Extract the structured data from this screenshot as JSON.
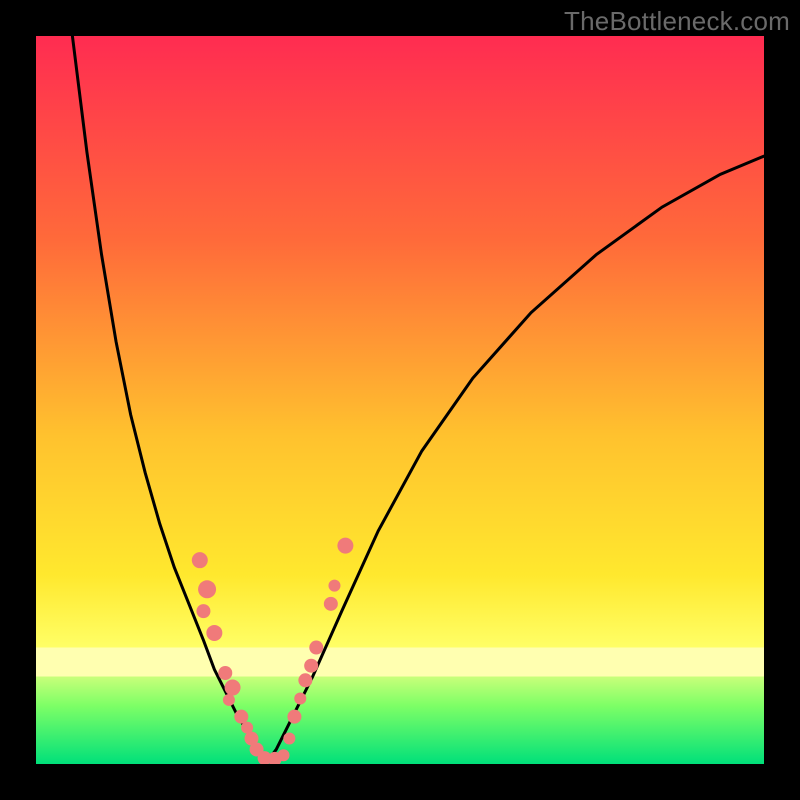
{
  "watermark": "TheBottleneck.com",
  "chart_data": {
    "type": "line",
    "title": "",
    "xlabel": "",
    "ylabel": "",
    "xlim": [
      0,
      100
    ],
    "ylim": [
      0,
      100
    ],
    "background_gradient": {
      "top": "#ff2c51",
      "mid_high": "#ff8a2e",
      "mid": "#ffe32e",
      "low_band_top": "#ffff8a",
      "green_top": "#8aff6a",
      "green_bottom": "#00e07a"
    },
    "curve_1": {
      "description": "left descending branch",
      "x": [
        5,
        7,
        9,
        11,
        13,
        15,
        17,
        19,
        21,
        23,
        24.5,
        26,
        27.5,
        29,
        30,
        31,
        31.5
      ],
      "y": [
        100,
        84,
        70,
        58,
        48,
        40,
        33,
        27,
        22,
        17,
        13,
        10,
        7,
        4.5,
        2.5,
        1,
        0
      ]
    },
    "curve_2": {
      "description": "right ascending branch",
      "x": [
        31.5,
        33,
        35,
        38,
        42,
        47,
        53,
        60,
        68,
        77,
        86,
        94,
        100
      ],
      "y": [
        0,
        2,
        6,
        12,
        21,
        32,
        43,
        53,
        62,
        70,
        76.5,
        81,
        83.5
      ]
    },
    "scatter_points": {
      "description": "pink/salmon data markers near bottom of V",
      "color": "#f07a7a",
      "points": [
        {
          "x": 22.5,
          "y": 28,
          "r": 8
        },
        {
          "x": 23.5,
          "y": 24,
          "r": 9
        },
        {
          "x": 23.0,
          "y": 21,
          "r": 7
        },
        {
          "x": 24.5,
          "y": 18,
          "r": 8
        },
        {
          "x": 26.0,
          "y": 12.5,
          "r": 7
        },
        {
          "x": 27.0,
          "y": 10.5,
          "r": 8
        },
        {
          "x": 26.5,
          "y": 8.8,
          "r": 6
        },
        {
          "x": 28.2,
          "y": 6.5,
          "r": 7
        },
        {
          "x": 29.0,
          "y": 5.0,
          "r": 6
        },
        {
          "x": 29.6,
          "y": 3.5,
          "r": 7
        },
        {
          "x": 30.3,
          "y": 2.0,
          "r": 7
        },
        {
          "x": 31.4,
          "y": 0.8,
          "r": 7
        },
        {
          "x": 32.8,
          "y": 0.7,
          "r": 7
        },
        {
          "x": 34.0,
          "y": 1.2,
          "r": 6
        },
        {
          "x": 34.8,
          "y": 3.5,
          "r": 6
        },
        {
          "x": 35.5,
          "y": 6.5,
          "r": 7
        },
        {
          "x": 36.3,
          "y": 9.0,
          "r": 6
        },
        {
          "x": 37.0,
          "y": 11.5,
          "r": 7
        },
        {
          "x": 37.8,
          "y": 13.5,
          "r": 7
        },
        {
          "x": 38.5,
          "y": 16.0,
          "r": 7
        },
        {
          "x": 40.5,
          "y": 22.0,
          "r": 7
        },
        {
          "x": 41.0,
          "y": 24.5,
          "r": 6
        },
        {
          "x": 42.5,
          "y": 30.0,
          "r": 8
        }
      ]
    },
    "green_band_y_top": 12,
    "cream_band_y_top": 16
  }
}
